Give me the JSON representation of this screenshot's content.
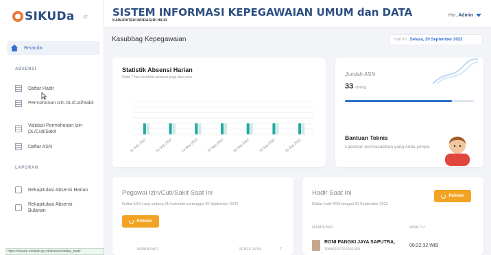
{
  "brand": {
    "name": "SIKUDa"
  },
  "sidebar": {
    "collapse_glyph": "«",
    "home_label": "Beranda",
    "section_absensi": "ABSENSI",
    "absensi_items": [
      {
        "label": "Daftar Hadir",
        "icon": "table-icon"
      },
      {
        "label": "Permohonan Izin DL/Cuti/Sakit",
        "icon": "table-icon"
      },
      {
        "label": "Validasi Permohonan Izin DL/Cuti/Sakit",
        "icon": "table-icon"
      },
      {
        "label": "Daftar ASN",
        "icon": "table-icon"
      }
    ],
    "section_laporan": "LAPORAN",
    "laporan_items": [
      {
        "label": "Rekapitulasi Absensi Harian",
        "icon": "printer-icon"
      },
      {
        "label": "Rekapitulasi Absensi Bulanan",
        "icon": "printer-icon"
      }
    ]
  },
  "status_url": "https://sikuda.inhilkab.go.id/absensi/daftar_hadir",
  "header": {
    "title": "SISTEM INFORMASI KEPEGAWAIAN UMUM dan DATA",
    "subtitle": "KABUPATEN INDRAGIRI HILIR",
    "greeting": "Hai,",
    "user": "Admin"
  },
  "breadcrumb": "Kasubbag Kepegawaian",
  "date": {
    "prefix": "Hari ini :",
    "value": "Selasa, 20 September 2022"
  },
  "colors": {
    "primary": "#2d6fcf",
    "brand": "#2d4e80",
    "accent": "#f3a323",
    "bar": "#1fa9a0"
  },
  "stat_card": {
    "title": "Statistik Absensi Harian",
    "desc": "Data 7 hari terakhir absensi pagi dan sore",
    "chart_data": {
      "type": "bar",
      "categories": [
        "12 Sep 2022",
        "13 Sep 2022",
        "14 Sep 2022",
        "15 Sep 2022",
        "16 Sep 2022",
        "19 Sep 2022",
        "20 Sep 2022"
      ],
      "series": [
        {
          "values": [
            1,
            1,
            1,
            1,
            1,
            1,
            1
          ]
        },
        {
          "values": [
            1,
            1,
            1,
            1,
            1,
            1,
            1
          ]
        }
      ],
      "ylim": [
        0,
        3
      ],
      "grid": true
    }
  },
  "asn_card": {
    "label": "Jumlah ASN",
    "value": "33",
    "unit": "Orang",
    "progress": 0.83,
    "bantuan_title": "Bantuan Teknis",
    "bantuan_desc": "Laporkan permasalahan yang Anda jumpai"
  },
  "izin_card": {
    "title": "Pegawai Izin/Cuti/Sakit Saat Ini",
    "desc": "Daftar ASN yang sedang DL/cuti/sakit pertanggal 20 September 2022",
    "refresh": "Refresh",
    "col_name": "NAMA/NIP",
    "col_jenis": "JENIS IZIN",
    "col_extra": "T"
  },
  "hadir_card": {
    "title": "Hadir Saat Ini",
    "desc": "Daftar hadir ASN tanggal 20 September 2022",
    "refresh": "Refresh",
    "col_name": "NAMA/NIP",
    "col_time": "WAKTU",
    "rows": [
      {
        "name": "RONI PANGKI JAYA SAPUTRA,",
        "nip": "19840107201001020",
        "time": "08:22:32 WIB"
      }
    ]
  }
}
